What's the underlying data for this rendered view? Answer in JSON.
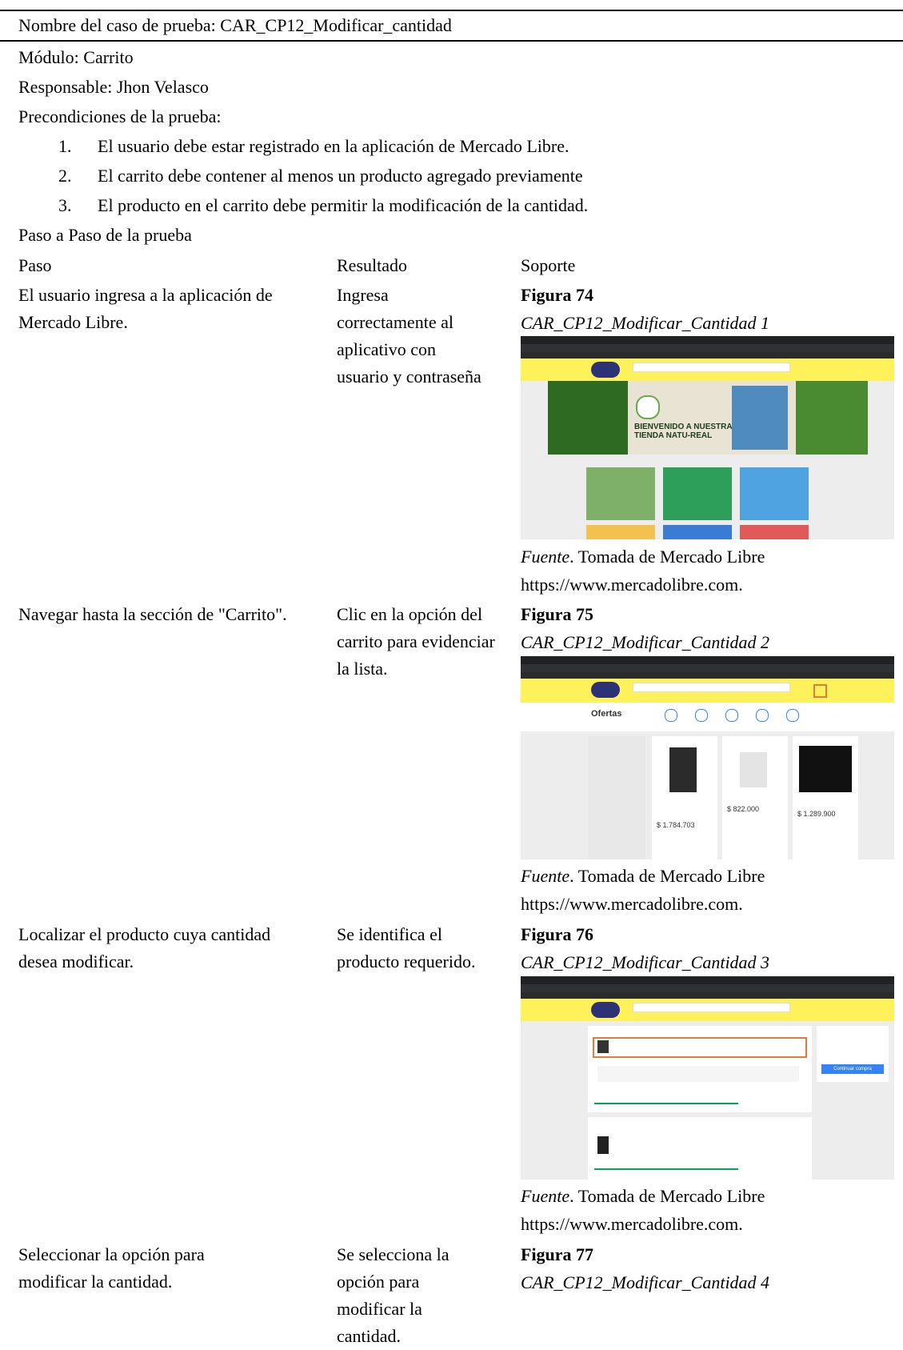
{
  "header": {
    "test_case_name": "Nombre del caso de prueba: CAR_CP12_Modificar_cantidad",
    "module": "Módulo: Carrito",
    "responsible": "Responsable: Jhon Velasco",
    "preconditions_title": "Precondiciones de la prueba:"
  },
  "preconditions": [
    {
      "num": "1.",
      "text": "El usuario debe estar registrado en la aplicación de Mercado Libre."
    },
    {
      "num": "2.",
      "text": "El carrito debe contener al menos un producto agregado previamente"
    },
    {
      "num": "3.",
      "text": "El producto en el carrito debe permitir la modificación de la cantidad."
    }
  ],
  "steps_title": "Paso a Paso de la prueba",
  "columns": {
    "step": "Paso",
    "result": "Resultado",
    "support": "Soporte"
  },
  "steps": [
    {
      "step": "El usuario ingresa a la aplicación de Mercado Libre.",
      "result": "Ingresa correctamente al aplicativo con usuario y contraseña",
      "figure": "Figura 74",
      "caption": "CAR_CP12_Modificar_Cantidad 1",
      "source_label": "Fuente",
      "source_text": ". Tomada de Mercado Libre",
      "source_url": "https://www.mercadolibre.com.",
      "banner_text": "BIENVENIDO A NUESTRA TIENDA NATU-REAL"
    },
    {
      "step": "Navegar hasta la sección de \"Carrito\".",
      "result": "Clic en la opción del carrito para evidenciar la lista.",
      "figure": "Figura 75",
      "caption": "CAR_CP12_Modificar_Cantidad 2",
      "source_label": "Fuente",
      "source_text": ". Tomada de Mercado Libre",
      "source_url": "https://www.mercadolibre.com.",
      "page_heading": "Ofertas",
      "prices": [
        "$ 1.784.703",
        "$ 822.000",
        "$ 1.289.900"
      ]
    },
    {
      "step": "Localizar el producto cuya cantidad desea modificar.",
      "result": "Se identifica el producto requerido.",
      "figure": "Figura 76",
      "caption": "CAR_CP12_Modificar_Cantidad 3",
      "source_label": "Fuente",
      "source_text": ". Tomada de Mercado Libre",
      "source_url": "https://www.mercadolibre.com.",
      "button_label": "Continuar compra"
    },
    {
      "step": "Seleccionar la opción para modificar la cantidad.",
      "result": "Se selecciona la opción para modificar la cantidad.",
      "figure": "Figura 77",
      "caption": "CAR_CP12_Modificar_Cantidad 4"
    }
  ],
  "colors": {
    "mercadolibre_yellow": "#fff159",
    "highlight_orange": "#e07b39",
    "chrome_dark": "#202124",
    "blue_button": "#3483fa"
  }
}
